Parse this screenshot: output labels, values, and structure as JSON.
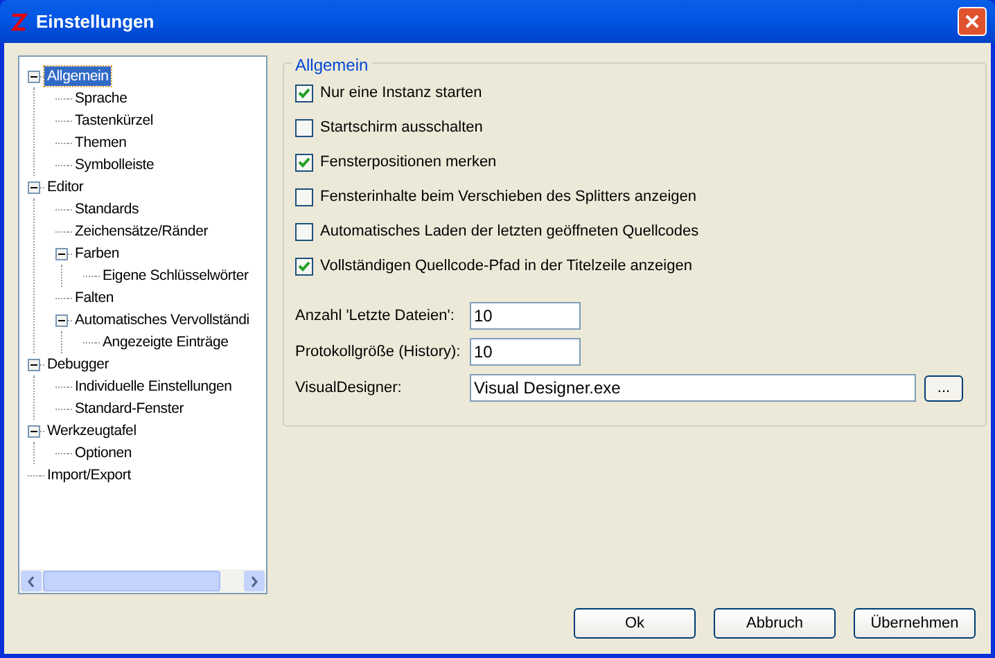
{
  "window": {
    "title": "Einstellungen"
  },
  "tree": [
    {
      "label": "Allgemein",
      "selected": true,
      "expanded": true,
      "children": [
        {
          "label": "Sprache",
          "selected": false
        },
        {
          "label": "Tastenkürzel",
          "selected": false
        },
        {
          "label": "Themen",
          "selected": false
        },
        {
          "label": "Symbolleiste",
          "selected": false
        }
      ]
    },
    {
      "label": "Editor",
      "selected": false,
      "expanded": true,
      "children": [
        {
          "label": "Standards",
          "selected": false
        },
        {
          "label": "Zeichensätze/Ränder",
          "selected": false
        },
        {
          "label": "Farben",
          "selected": false,
          "expanded": true,
          "children": [
            {
              "label": "Eigene Schlüsselwörter",
              "selected": false
            }
          ]
        },
        {
          "label": "Falten",
          "selected": false
        },
        {
          "label": "Automatisches Vervollständi",
          "selected": false,
          "expanded": true,
          "children": [
            {
              "label": "Angezeigte Einträge",
              "selected": false
            }
          ]
        }
      ]
    },
    {
      "label": "Debugger",
      "selected": false,
      "expanded": true,
      "children": [
        {
          "label": "Individuelle Einstellungen",
          "selected": false
        },
        {
          "label": "Standard-Fenster",
          "selected": false
        }
      ]
    },
    {
      "label": "Werkzeugtafel",
      "selected": false,
      "expanded": true,
      "children": [
        {
          "label": "Optionen",
          "selected": false
        }
      ]
    },
    {
      "label": "Import/Export",
      "selected": false
    }
  ],
  "group": {
    "title": "Allgemein",
    "checkboxes": [
      {
        "label": "Nur eine Instanz starten",
        "checked": true
      },
      {
        "label": "Startschirm ausschalten",
        "checked": false
      },
      {
        "label": "Fensterpositionen merken",
        "checked": true
      },
      {
        "label": "Fensterinhalte beim Verschieben des Splitters anzeigen",
        "checked": false
      },
      {
        "label": "Automatisches Laden der letzten geöffneten Quellcodes",
        "checked": false
      },
      {
        "label": "Vollständigen Quellcode-Pfad in der Titelzeile anzeigen",
        "checked": true
      }
    ],
    "fields": [
      {
        "label": "Anzahl 'Letzte Dateien':",
        "value": "10",
        "kind": "short"
      },
      {
        "label": "Protokollgröße (History):",
        "value": "10",
        "kind": "short"
      },
      {
        "label": "VisualDesigner:",
        "value": "Visual Designer.exe",
        "kind": "browse",
        "button": "..."
      }
    ]
  },
  "buttons": [
    "Ok",
    "Abbruch",
    "Übernehmen"
  ]
}
